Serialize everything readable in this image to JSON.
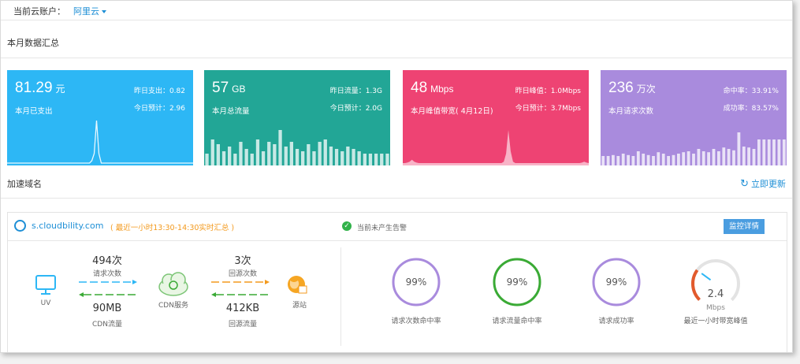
{
  "account": {
    "label": "当前云账户：",
    "value": "阿里云"
  },
  "summary_title": "本月数据汇总",
  "cards": [
    {
      "color": "#2db7f5",
      "value": "81.29",
      "unit": "元",
      "sub": "本月已支出",
      "r1": "昨日支出：0.82",
      "r2": "今日预计：2.96",
      "spark": [
        0.05,
        0.05,
        0.05,
        0.05,
        0.05,
        0.05,
        0.05,
        0.05,
        0.05,
        0.05,
        0.05,
        0.05,
        0.05,
        0.05,
        0.05,
        0.05,
        0.05,
        0.05,
        0.05,
        0.05,
        0.05,
        0.05,
        0.05,
        0.05,
        0.05,
        0.05,
        0.05,
        0.05,
        0.05,
        0.05,
        0.05,
        0.05,
        0.05,
        0.05,
        0.05,
        0.05,
        0.1,
        0.25,
        0.95,
        0.25,
        0.05,
        0.05,
        0.05,
        0.05,
        0.05,
        0.05,
        0.05,
        0.05,
        0.05,
        0.05,
        0.05,
        0.05,
        0.05,
        0.05,
        0.05,
        0.05,
        0.05,
        0.05,
        0.05,
        0.05,
        0.05,
        0.05,
        0.05,
        0.05,
        0.05,
        0.05,
        0.05,
        0.05,
        0.05,
        0.05,
        0.05,
        0.05,
        0.05,
        0.05,
        0.05,
        0.05,
        0.05,
        0.05,
        0.05,
        0.05
      ],
      "style": "line"
    },
    {
      "color": "#22a696",
      "value": "57",
      "unit": "GB",
      "sub": "本月总流量",
      "r1": "昨日流量：1.3G",
      "r2": "今日预计：2.0G",
      "bars": [
        0.25,
        0.55,
        0.45,
        0.3,
        0.4,
        0.25,
        0.5,
        0.35,
        0.25,
        0.55,
        0.3,
        0.5,
        0.45,
        0.75,
        0.4,
        0.5,
        0.35,
        0.3,
        0.45,
        0.3,
        0.5,
        0.55,
        0.4,
        0.35,
        0.3,
        0.4,
        0.35,
        0.3,
        0.25,
        0.25,
        0.25,
        0.25,
        0.25
      ],
      "style": "bars"
    },
    {
      "color": "#ee4373",
      "value": "48",
      "unit": "Mbps",
      "sub": "本月峰值带宽( 4月12日)",
      "r1": "昨日峰值：1.0Mbps",
      "r2": "今日预计：3.7Mbps",
      "spark": [
        0.05,
        0.05,
        0.06,
        0.08,
        0.12,
        0.08,
        0.06,
        0.05,
        0.05,
        0.05,
        0.05,
        0.05,
        0.05,
        0.05,
        0.05,
        0.05,
        0.05,
        0.05,
        0.05,
        0.05,
        0.05,
        0.05,
        0.05,
        0.05,
        0.05,
        0.05,
        0.05,
        0.05,
        0.05,
        0.05,
        0.05,
        0.05,
        0.05,
        0.05,
        0.05,
        0.05,
        0.05,
        0.05,
        0.05,
        0.05,
        0.05,
        0.05,
        0.05,
        0.05,
        0.08,
        0.25,
        0.75,
        0.3,
        0.08,
        0.05,
        0.05,
        0.05,
        0.05,
        0.05,
        0.05,
        0.05,
        0.05,
        0.05,
        0.05,
        0.05,
        0.05,
        0.05,
        0.05,
        0.05,
        0.05,
        0.05,
        0.05,
        0.05,
        0.05,
        0.05,
        0.05,
        0.05,
        0.05,
        0.05,
        0.05,
        0.05,
        0.05,
        0.05,
        0.06,
        0.08,
        0.06,
        0.05
      ],
      "style": "area"
    },
    {
      "color": "#a98bdd",
      "value": "236",
      "unit": "万次",
      "sub": "本月请求次数",
      "r1": "命中率：33.91%",
      "r2": "成功率：83.57%",
      "bars": [
        0.2,
        0.2,
        0.22,
        0.2,
        0.25,
        0.22,
        0.2,
        0.3,
        0.25,
        0.22,
        0.2,
        0.28,
        0.25,
        0.2,
        0.22,
        0.25,
        0.28,
        0.3,
        0.25,
        0.35,
        0.3,
        0.28,
        0.35,
        0.3,
        0.38,
        0.35,
        0.32,
        0.7,
        0.4,
        0.38,
        0.35,
        0.55,
        0.55,
        0.55,
        0.55,
        0.55,
        0.55
      ],
      "style": "bars"
    }
  ],
  "domain_section_title": "加速域名",
  "refresh_label": "立即更新",
  "domain": {
    "name": "s.cloudbility.com",
    "note": "( 最近一小时13:30-14:30实时汇总 )",
    "alarm": "当前未产生告警",
    "monitor_btn": "监控详情",
    "requests": "494次",
    "requests_label": "请求次数",
    "cdn_traffic": "90MB",
    "cdn_traffic_label": "CDN流量",
    "origin_requests": "3次",
    "origin_requests_label": "回源次数",
    "origin_traffic": "412KB",
    "origin_traffic_label": "回源流量",
    "uv_label": "UV",
    "cdn_label": "CDN服务",
    "origin_label": "源站",
    "rings": [
      {
        "value": "99%",
        "label": "请求次数命中率",
        "color": "#a98bdd"
      },
      {
        "value": "99%",
        "label": "请求流量命中率",
        "color": "#3aaa35"
      },
      {
        "value": "99%",
        "label": "请求成功率",
        "color": "#a98bdd"
      }
    ],
    "gauge": {
      "value": "2.4",
      "unit": "Mbps",
      "label": "最近一小时带宽峰值",
      "level": 0.3
    }
  }
}
